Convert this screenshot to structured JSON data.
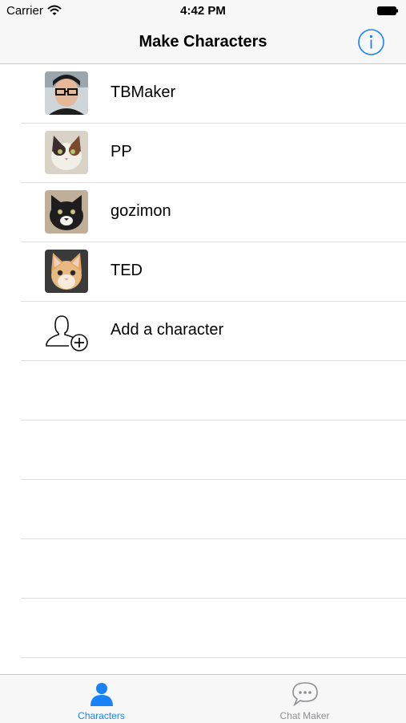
{
  "status_bar": {
    "carrier": "Carrier",
    "time": "4:42 PM"
  },
  "nav": {
    "title": "Make Characters",
    "info_icon": "info-icon"
  },
  "characters": [
    {
      "name": "TBMaker",
      "avatar": "person-photo"
    },
    {
      "name": "PP",
      "avatar": "cat-photo"
    },
    {
      "name": "gozimon",
      "avatar": "cat-photo"
    },
    {
      "name": "TED",
      "avatar": "kitten-photo"
    }
  ],
  "add_character": {
    "label": "Add a character",
    "icon": "add-user-icon"
  },
  "tabs": [
    {
      "label": "Characters",
      "icon": "person-icon",
      "active": true
    },
    {
      "label": "Chat Maker",
      "icon": "chat-bubble-icon",
      "active": false
    }
  ],
  "colors": {
    "accent": "#1a82f7",
    "inactive": "#8e8e93"
  }
}
